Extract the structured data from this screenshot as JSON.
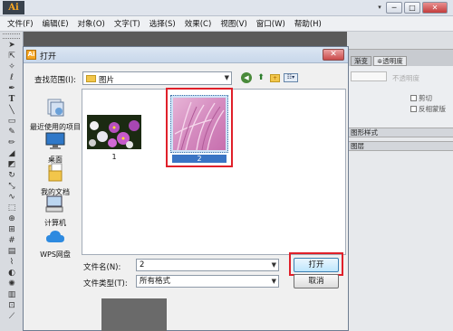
{
  "app": {
    "logo": "Ai",
    "window_controls": [
      "▾",
      "─",
      "□",
      "✕"
    ]
  },
  "menu": [
    "文件(F)",
    "编辑(E)",
    "对象(O)",
    "文字(T)",
    "选择(S)",
    "效果(C)",
    "视图(V)",
    "窗口(W)",
    "帮助(H)"
  ],
  "panels": {
    "tabs": [
      "渐变",
      "≑透明度"
    ],
    "blend_mode_partial": "不透明度",
    "checkboxes": [
      "剪切",
      "反相蒙版"
    ],
    "graphic_styles": "图形样式",
    "layers": "图层"
  },
  "dialog": {
    "title": "打开",
    "close": "✕",
    "lookin_label": "查找范围(I):",
    "lookin_value": "图片",
    "places": [
      {
        "label": "最近使用的项目",
        "icon": "recent-icon"
      },
      {
        "label": "桌面",
        "icon": "desktop-icon"
      },
      {
        "label": "我的文档",
        "icon": "documents-icon"
      },
      {
        "label": "计算机",
        "icon": "computer-icon"
      },
      {
        "label": "WPS网盘",
        "icon": "cloud-icon"
      }
    ],
    "files": [
      {
        "name": "1",
        "selected": false
      },
      {
        "name": "2",
        "selected": true
      }
    ],
    "filename_label": "文件名(N):",
    "filename_value": "2",
    "filetype_label": "文件类型(T):",
    "filetype_value": "所有格式",
    "open_button": "打开",
    "cancel_button": "取消"
  },
  "colors": {
    "highlight": "#e0202a",
    "selection": "#cfe3f7"
  }
}
